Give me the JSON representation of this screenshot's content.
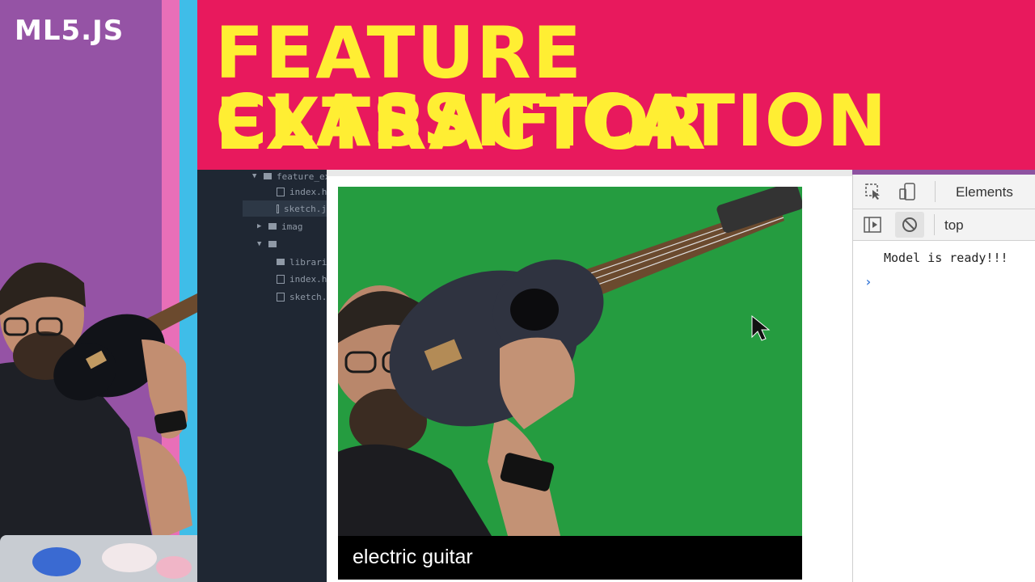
{
  "logo": {
    "text": "ML5.JS"
  },
  "banner": {
    "line1": "FEATURE EXTRACTOR",
    "line2": "CLASSIFICATION",
    "background_color": "#e8195d",
    "text_color": "#ffee33"
  },
  "editor": {
    "items": [
      {
        "label": "feature_ext",
        "type": "folder",
        "expanded": true
      },
      {
        "label": "index.ht",
        "type": "file"
      },
      {
        "label": "sketch.j",
        "type": "file",
        "selected": true
      },
      {
        "label": "imag",
        "type": "folder",
        "expanded": false
      },
      {
        "label": "",
        "type": "folder",
        "expanded": true
      },
      {
        "label": "libraries",
        "type": "folder"
      },
      {
        "label": "index.ht",
        "type": "file"
      },
      {
        "label": "sketch.j",
        "type": "file"
      }
    ]
  },
  "canvas": {
    "classification_label": "electric guitar",
    "background_color": "#27a043"
  },
  "devtools": {
    "tab_label": "Elements",
    "context": "top",
    "console_messages": [
      "Model is ready!!!"
    ],
    "prompt_symbol": "›",
    "icons": [
      "inspect-cursor-icon",
      "device-toggle-icon",
      "sidebar-toggle-icon",
      "clear-console-icon"
    ]
  },
  "colors": {
    "left_column": "#9553a5",
    "stripe_pink": "#e86fb8",
    "stripe_blue": "#3fbde8"
  }
}
